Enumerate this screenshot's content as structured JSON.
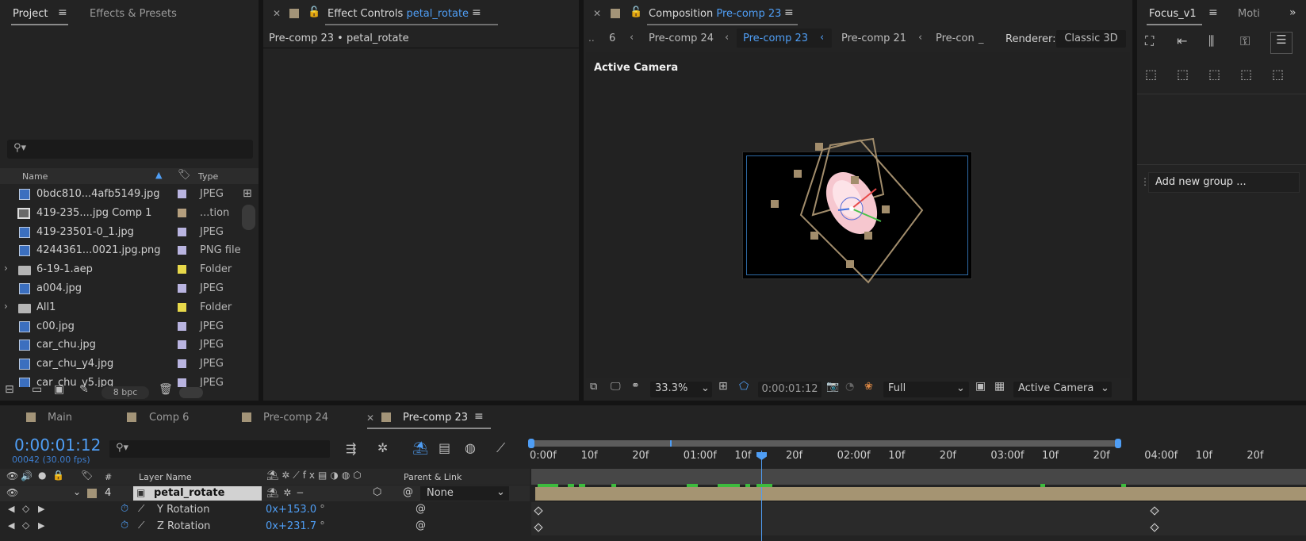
{
  "project_panel": {
    "tab_project": "Project",
    "tab_effects": "Effects & Presets",
    "col_name": "Name",
    "col_type": "Type",
    "bpc": "8 bpc",
    "items": [
      {
        "name": "0bdc810...4afb5149.jpg",
        "type": "JPEG",
        "label": "#b9b4e0"
      },
      {
        "name": "419-235....jpg Comp 1",
        "type": "...tion",
        "label": "#b59f7e"
      },
      {
        "name": "419-23501-0_1.jpg",
        "type": "JPEG",
        "label": "#b9b4e0"
      },
      {
        "name": "4244361...0021.jpg.png",
        "type": "PNG file",
        "label": "#b9b4e0"
      },
      {
        "name": "6-19-1.aep",
        "type": "Folder",
        "label": "#e8d94a"
      },
      {
        "name": "a004.jpg",
        "type": "JPEG",
        "label": "#b9b4e0"
      },
      {
        "name": "All1",
        "type": "Folder",
        "label": "#e8d94a"
      },
      {
        "name": "c00.jpg",
        "type": "JPEG",
        "label": "#b9b4e0"
      },
      {
        "name": "car_chu.jpg",
        "type": "JPEG",
        "label": "#b9b4e0"
      },
      {
        "name": "car_chu_y4.jpg",
        "type": "JPEG",
        "label": "#b9b4e0"
      },
      {
        "name": "car_chu_y5.jpg",
        "type": "JPEG",
        "label": "#b9b4e0"
      }
    ]
  },
  "effect_controls": {
    "title": "Effect Controls",
    "layer": "petal_rotate",
    "breadcrumb": "Pre-comp 23 • petal_rotate"
  },
  "composition": {
    "title": "Composition",
    "comp_name": "Pre-comp 23",
    "nav": [
      "6",
      "Pre-comp 24",
      "Pre-comp 23",
      "Pre-comp 21",
      "Pre-con"
    ],
    "renderer_label": "Renderer:",
    "renderer_value": "Classic 3D",
    "view_label": "Active Camera",
    "zoom": "33.3%",
    "timecode": "0:00:01:12",
    "resolution": "Full",
    "camera": "Active Camera"
  },
  "focus_panel": {
    "tab": "Focus_v1",
    "tab2": "Moti",
    "add_group": "Add new group ..."
  },
  "timeline": {
    "tabs": [
      "Main",
      "Comp 6",
      "Pre-comp 24",
      "Pre-comp 23"
    ],
    "timecode": "0:00:01:12",
    "frame_info": "00042 (30.00 fps)",
    "col_num": "#",
    "col_layer": "Layer Name",
    "col_parent": "Parent & Link",
    "layer_index": "4",
    "layer_name": "petal_rotate",
    "parent_value": "None",
    "props": [
      {
        "name": "Y Rotation",
        "value_prefix": "0",
        "value": "x+153.0",
        "unit": "°"
      },
      {
        "name": "Z Rotation",
        "value_prefix": "0",
        "value": "x+231.7",
        "unit": "°"
      }
    ],
    "ruler": [
      "0:00f",
      "10f",
      "20f",
      "01:00f",
      "10f",
      "20f",
      "02:00f",
      "10f",
      "20f",
      "03:00f",
      "10f",
      "20f",
      "04:00f",
      "10f",
      "20f"
    ]
  },
  "colors": {
    "accent": "#4f9ef5",
    "layer_bar": "#a59472",
    "work_area_green": "#3dbb3d"
  }
}
